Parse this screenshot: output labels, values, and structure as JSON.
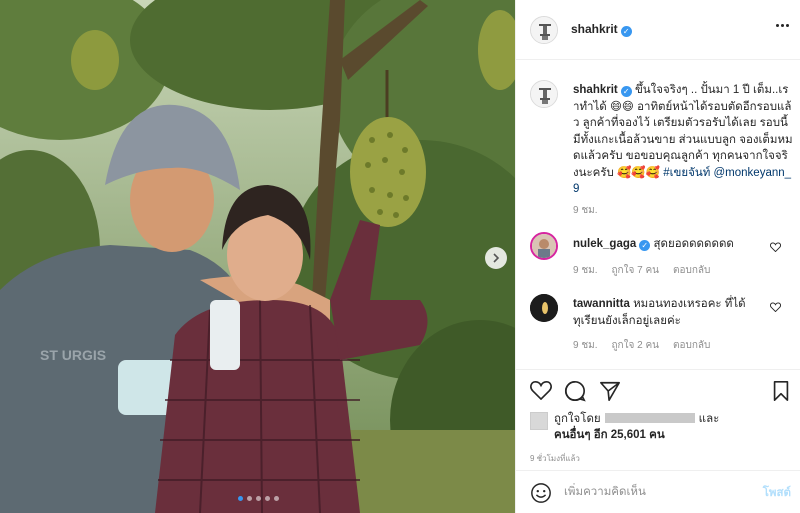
{
  "post": {
    "username": "shahkrit",
    "verified": true
  },
  "caption": {
    "username": "shahkrit",
    "text": " ขึ้นใจจริงๆ .. ปั้นมา 1 ปี เต็ม..เราทำได้ 😄😄 อาทิตย์หน้าได้รอบตัดอีกรอบแล้ว ลูกค้าที่จองไว้ เตรียมตัวรอรับได้เลย รอบนี้ มีทั้งแกะเนื้อล้วนขาย ส่วนแบบลูก จองเต็มหมดแล้วครับ ขอขอบคุณลูกค้า ทุกคนจากใจจริงนะครับ 🥰🥰🥰",
    "hashtag": "#เขยจันท์",
    "mention": "@monkeyann_9",
    "time": "9 ชม."
  },
  "comments": [
    {
      "username": "nulek_gaga",
      "verified": true,
      "text": "สุดยอดดดดดดด",
      "time": "9 ชม.",
      "likes": "ถูกใจ 7 คน",
      "reply": "ตอบกลับ"
    },
    {
      "username": "tawannitta",
      "verified": false,
      "text": "หมอนทองเหรอคะ ที่ได้ทุเรียนยังเล็กอยู่เลยค่ะ",
      "time": "9 ชม.",
      "likes": "ถูกใจ 2 คน",
      "reply": "ตอบกลับ"
    }
  ],
  "likes": {
    "liked_by": "ถูกใจโดย",
    "and": "และ",
    "others": "คนอื่นๆ อีก 25,601 คน"
  },
  "post_age": "9 ชั่วโมงที่แล้ว",
  "add_comment": {
    "placeholder": "เพิ่มความคิดเห็น",
    "post_label": "โพสต์"
  },
  "carousel": {
    "count": 5,
    "active": 1
  },
  "icons": {
    "more": "more-options-icon",
    "heart": "heart-icon",
    "comment": "comment-icon",
    "share": "share-icon",
    "save": "bookmark-icon",
    "emoji": "emoji-icon",
    "next": "chevron-right-icon"
  },
  "colors": {
    "verified": "#3897f0",
    "link": "#00376b",
    "muted": "#8e8e8e",
    "post_button": "#b2dffc"
  }
}
